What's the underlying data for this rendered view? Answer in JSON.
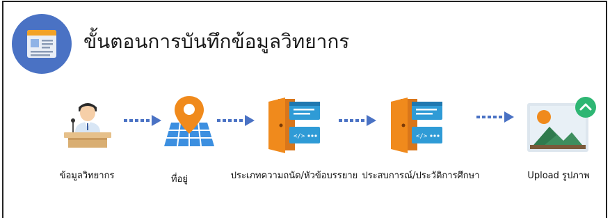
{
  "title": "ขั้นตอนการบันทึกข้อมูลวิทยากร",
  "steps": [
    {
      "label": "ข้อมูลวิทยากร",
      "icon": "speaker-podium-icon"
    },
    {
      "label": "ที่อยู่",
      "icon": "map-pin-icon"
    },
    {
      "label": "ประเภทความถนัด/หัวข้อบรรยาย",
      "icon": "door-code-window-icon"
    },
    {
      "label": "ประสบการณ์/ประวัติการศึกษา",
      "icon": "door-code-window-icon"
    },
    {
      "label": "Upload รูปภาพ",
      "icon": "image-upload-icon"
    }
  ],
  "colors": {
    "header_circle": "#4A72C4",
    "arrow": "#4A72C4",
    "orange": "#F08A1C",
    "teal": "#2F9BD6",
    "green_badge": "#2EB673"
  }
}
